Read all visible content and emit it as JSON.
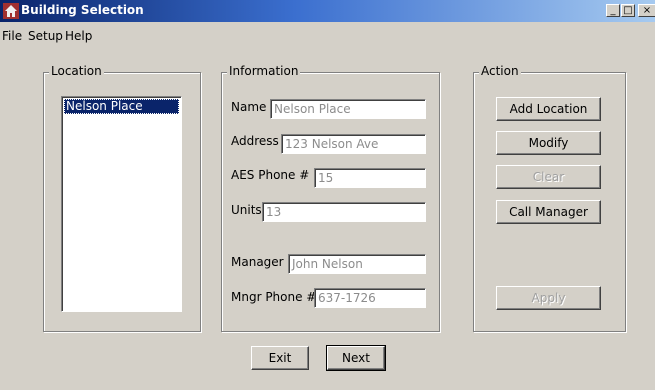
{
  "window": {
    "title": "Building Selection",
    "controls": {
      "minimize": "_",
      "maximize": "□",
      "close": "×"
    },
    "accent_color": "#0a246a"
  },
  "menu": [
    "File",
    "Setup",
    "Help"
  ],
  "location_group": {
    "label": "Location",
    "items": [
      "Nelson Place"
    ],
    "selected_index": 0
  },
  "information_group": {
    "label": "Information",
    "name": {
      "label": "Name",
      "value": "Nelson Place"
    },
    "address": {
      "label": "Address",
      "value": "123 Nelson Ave"
    },
    "aes_phone": {
      "label": "AES Phone #",
      "value": "15"
    },
    "units": {
      "label": "Units",
      "value": "13"
    },
    "manager": {
      "label": "Manager",
      "value": "John Nelson"
    },
    "mngr_phone": {
      "label": "Mngr Phone #",
      "value": "637-1726"
    }
  },
  "action_group": {
    "label": "Action",
    "add_location": "Add Location",
    "modify": "Modify",
    "clear": "Clear",
    "call_manager": "Call Manager",
    "apply": "Apply"
  },
  "footer": {
    "exit": "Exit",
    "next": "Next"
  }
}
